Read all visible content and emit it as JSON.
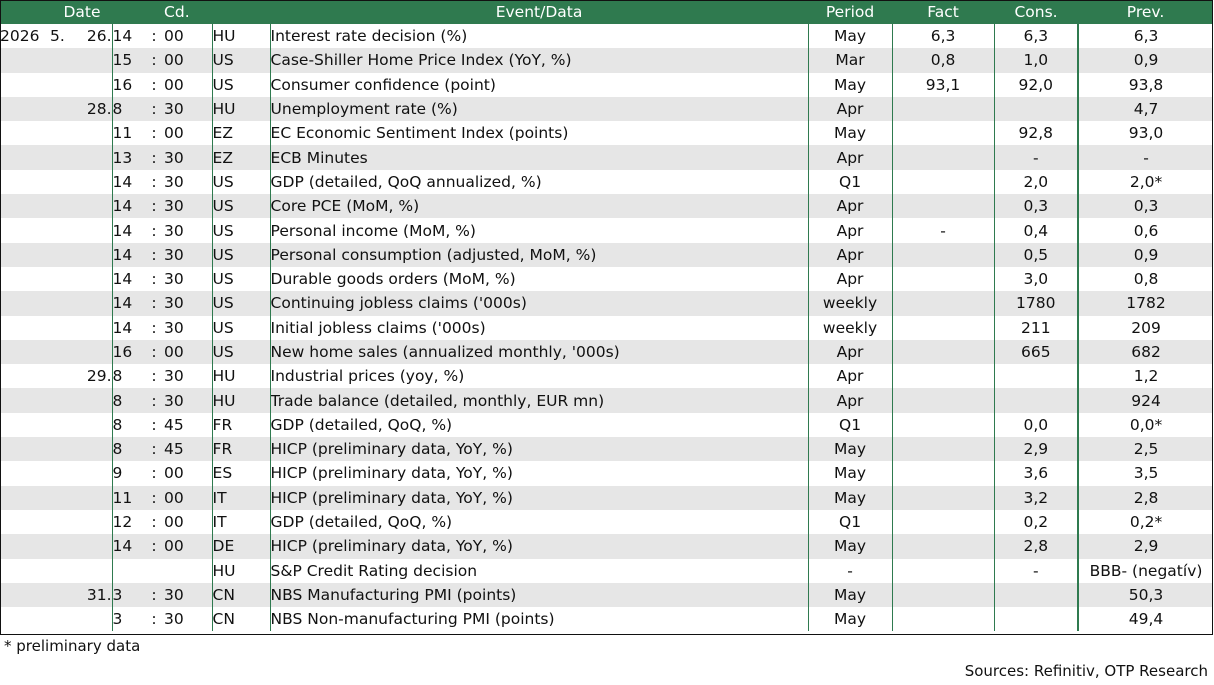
{
  "headers": {
    "date": "Date",
    "code": "Cd.",
    "event": "Event/Data",
    "period": "Period",
    "fact": "Fact",
    "cons": "Cons.",
    "prev": "Prev."
  },
  "rows": [
    {
      "year": "2026",
      "month": "5.",
      "day": "26.",
      "hour": "14",
      "colon": ":",
      "min": "00",
      "code": "HU",
      "event": "Interest rate decision (%)",
      "period": "May",
      "fact": "6,3",
      "cons": "6,3",
      "prev": "6,3"
    },
    {
      "year": "",
      "month": "",
      "day": "",
      "hour": "15",
      "colon": ":",
      "min": "00",
      "code": "US",
      "event": "Case-Shiller Home Price Index (YoY, %)",
      "period": "Mar",
      "fact": "0,8",
      "cons": "1,0",
      "prev": "0,9"
    },
    {
      "year": "",
      "month": "",
      "day": "",
      "hour": "16",
      "colon": ":",
      "min": "00",
      "code": "US",
      "event": "Consumer confidence (point)",
      "period": "May",
      "fact": "93,1",
      "cons": "92,0",
      "prev": "93,8"
    },
    {
      "year": "",
      "month": "",
      "day": "28.",
      "hour": "8",
      "colon": ":",
      "min": "30",
      "code": "HU",
      "event": "Unemployment rate (%)",
      "period": "Apr",
      "fact": "",
      "cons": "",
      "prev": "4,7"
    },
    {
      "year": "",
      "month": "",
      "day": "",
      "hour": "11",
      "colon": ":",
      "min": "00",
      "code": "EZ",
      "event": "EC Economic Sentiment Index (points)",
      "period": "May",
      "fact": "",
      "cons": "92,8",
      "prev": "93,0"
    },
    {
      "year": "",
      "month": "",
      "day": "",
      "hour": "13",
      "colon": ":",
      "min": "30",
      "code": "EZ",
      "event": "ECB Minutes",
      "period": "Apr",
      "fact": "",
      "cons": "-",
      "prev": "-"
    },
    {
      "year": "",
      "month": "",
      "day": "",
      "hour": "14",
      "colon": ":",
      "min": "30",
      "code": "US",
      "event": "GDP (detailed, QoQ annualized, %)",
      "period": "Q1",
      "fact": "",
      "cons": "2,0",
      "prev": "2,0*"
    },
    {
      "year": "",
      "month": "",
      "day": "",
      "hour": "14",
      "colon": ":",
      "min": "30",
      "code": "US",
      "event": "Core PCE (MoM, %)",
      "period": "Apr",
      "fact": "",
      "cons": "0,3",
      "prev": "0,3"
    },
    {
      "year": "",
      "month": "",
      "day": "",
      "hour": "14",
      "colon": ":",
      "min": "30",
      "code": "US",
      "event": "Personal income (MoM, %)",
      "period": "Apr",
      "fact": "-",
      "cons": "0,4",
      "prev": "0,6"
    },
    {
      "year": "",
      "month": "",
      "day": "",
      "hour": "14",
      "colon": ":",
      "min": "30",
      "code": "US",
      "event": "Personal consumption (adjusted, MoM, %)",
      "period": "Apr",
      "fact": "",
      "cons": "0,5",
      "prev": "0,9"
    },
    {
      "year": "",
      "month": "",
      "day": "",
      "hour": "14",
      "colon": ":",
      "min": "30",
      "code": "US",
      "event": "Durable goods orders (MoM, %)",
      "period": "Apr",
      "fact": "",
      "cons": "3,0",
      "prev": "0,8"
    },
    {
      "year": "",
      "month": "",
      "day": "",
      "hour": "14",
      "colon": ":",
      "min": "30",
      "code": "US",
      "event": "Continuing jobless claims ('000s)",
      "period": "weekly",
      "fact": "",
      "cons": "1780",
      "prev": "1782"
    },
    {
      "year": "",
      "month": "",
      "day": "",
      "hour": "14",
      "colon": ":",
      "min": "30",
      "code": "US",
      "event": "Initial jobless claims ('000s)",
      "period": "weekly",
      "fact": "",
      "cons": "211",
      "prev": "209"
    },
    {
      "year": "",
      "month": "",
      "day": "",
      "hour": "16",
      "colon": ":",
      "min": "00",
      "code": "US",
      "event": "New home sales (annualized monthly, '000s)",
      "period": "Apr",
      "fact": "",
      "cons": "665",
      "prev": "682"
    },
    {
      "year": "",
      "month": "",
      "day": "29.",
      "hour": "8",
      "colon": ":",
      "min": "30",
      "code": "HU",
      "event": "Industrial prices (yoy, %)",
      "period": "Apr",
      "fact": "",
      "cons": "",
      "prev": "1,2"
    },
    {
      "year": "",
      "month": "",
      "day": "",
      "hour": "8",
      "colon": ":",
      "min": "30",
      "code": "HU",
      "event": "Trade balance (detailed, monthly, EUR mn)",
      "period": "Apr",
      "fact": "",
      "cons": "",
      "prev": "924"
    },
    {
      "year": "",
      "month": "",
      "day": "",
      "hour": "8",
      "colon": ":",
      "min": "45",
      "code": "FR",
      "event": "GDP (detailed, QoQ, %)",
      "period": "Q1",
      "fact": "",
      "cons": "0,0",
      "prev": "0,0*"
    },
    {
      "year": "",
      "month": "",
      "day": "",
      "hour": "8",
      "colon": ":",
      "min": "45",
      "code": "FR",
      "event": "HICP (preliminary data, YoY, %)",
      "period": "May",
      "fact": "",
      "cons": "2,9",
      "prev": "2,5"
    },
    {
      "year": "",
      "month": "",
      "day": "",
      "hour": "9",
      "colon": ":",
      "min": "00",
      "code": "ES",
      "event": "HICP (preliminary data, YoY, %)",
      "period": "May",
      "fact": "",
      "cons": "3,6",
      "prev": "3,5"
    },
    {
      "year": "",
      "month": "",
      "day": "",
      "hour": "11",
      "colon": ":",
      "min": "00",
      "code": "IT",
      "event": "HICP (preliminary data, YoY, %)",
      "period": "May",
      "fact": "",
      "cons": "3,2",
      "prev": "2,8"
    },
    {
      "year": "",
      "month": "",
      "day": "",
      "hour": "12",
      "colon": ":",
      "min": "00",
      "code": "IT",
      "event": "GDP (detailed, QoQ, %)",
      "period": "Q1",
      "fact": "",
      "cons": "0,2",
      "prev": "0,2*"
    },
    {
      "year": "",
      "month": "",
      "day": "",
      "hour": "14",
      "colon": ":",
      "min": "00",
      "code": "DE",
      "event": "HICP (preliminary data, YoY, %)",
      "period": "May",
      "fact": "",
      "cons": "2,8",
      "prev": "2,9"
    },
    {
      "year": "",
      "month": "",
      "day": "",
      "hour": "",
      "colon": "",
      "min": "",
      "code": "HU",
      "event": "S&P Credit Rating decision",
      "period": "-",
      "fact": "",
      "cons": "-",
      "prev": "BBB- (negatív)"
    },
    {
      "year": "",
      "month": "",
      "day": "31.",
      "hour": "3",
      "colon": ":",
      "min": "30",
      "code": "CN",
      "event": "NBS Manufacturing PMI (points)",
      "period": "May",
      "fact": "",
      "cons": "",
      "prev": "50,3"
    },
    {
      "year": "",
      "month": "",
      "day": "",
      "hour": "3",
      "colon": ":",
      "min": "30",
      "code": "CN",
      "event": "NBS Non-manufacturing PMI (points)",
      "period": "May",
      "fact": "",
      "cons": "",
      "prev": "49,4"
    }
  ],
  "footer": {
    "note": "* preliminary data",
    "source": "Sources: Refinitiv, OTP Research"
  }
}
